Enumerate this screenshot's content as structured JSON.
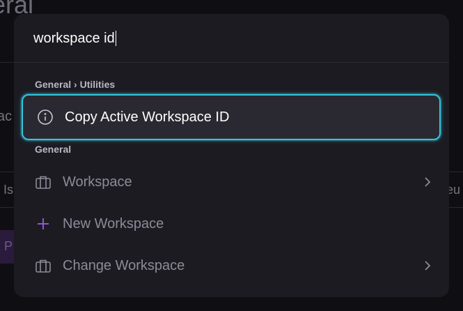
{
  "background": {
    "title_fragment": "eral",
    "left_fragment_1": "ac",
    "left_fragment_2": "Is",
    "right_fragment": "eu",
    "pill_fragment": "P"
  },
  "search": {
    "value": "workspace id",
    "placeholder": ""
  },
  "groups": [
    {
      "label": "General › Utilities",
      "items": [
        {
          "label": "Copy Active Workspace ID",
          "icon": "info-icon",
          "selected": true
        }
      ]
    },
    {
      "label": "General",
      "items": [
        {
          "label": "Workspace",
          "icon": "briefcase-icon",
          "has_submenu": true
        },
        {
          "label": "New Workspace",
          "icon": "plus-icon",
          "has_submenu": false
        },
        {
          "label": "Change Workspace",
          "icon": "briefcase-icon",
          "has_submenu": true
        }
      ]
    }
  ],
  "colors": {
    "focus_ring": "#35c6dc",
    "plus_accent": "#9b5de5",
    "palette_bg": "#1c1b22"
  }
}
